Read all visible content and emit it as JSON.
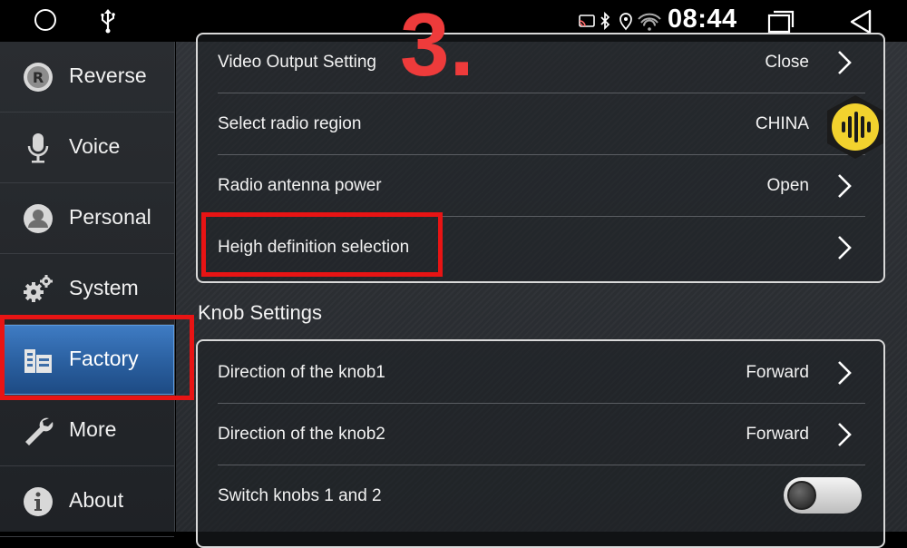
{
  "status_bar": {
    "time": "08:44"
  },
  "sidebar": {
    "items": [
      {
        "label": "Reverse",
        "icon": "reverse-icon"
      },
      {
        "label": "Voice",
        "icon": "microphone-icon"
      },
      {
        "label": "Personal",
        "icon": "person-icon"
      },
      {
        "label": "System",
        "icon": "gears-icon"
      },
      {
        "label": "Factory",
        "icon": "factory-icon",
        "active": true
      },
      {
        "label": "More",
        "icon": "wrench-icon"
      },
      {
        "label": "About",
        "icon": "info-icon"
      }
    ]
  },
  "general_rows": [
    {
      "label": "Video Output Setting",
      "value": "Close"
    },
    {
      "label": "Select radio region",
      "value": "CHINA"
    },
    {
      "label": "Radio antenna power",
      "value": "Open"
    },
    {
      "label": "Heigh definition selection",
      "value": ""
    }
  ],
  "knob_section": {
    "title": "Knob Settings",
    "rows": [
      {
        "label": "Direction of the knob1",
        "value": "Forward"
      },
      {
        "label": "Direction of the knob2",
        "value": "Forward"
      },
      {
        "label": "Switch knobs 1 and 2",
        "toggle": "off"
      }
    ]
  },
  "annotation": {
    "step": "3.",
    "color": "#e81414"
  },
  "colors": {
    "active_tab": "#2a5f9f",
    "highlight": "#e81414",
    "voice_fab": "#f2d22e"
  }
}
